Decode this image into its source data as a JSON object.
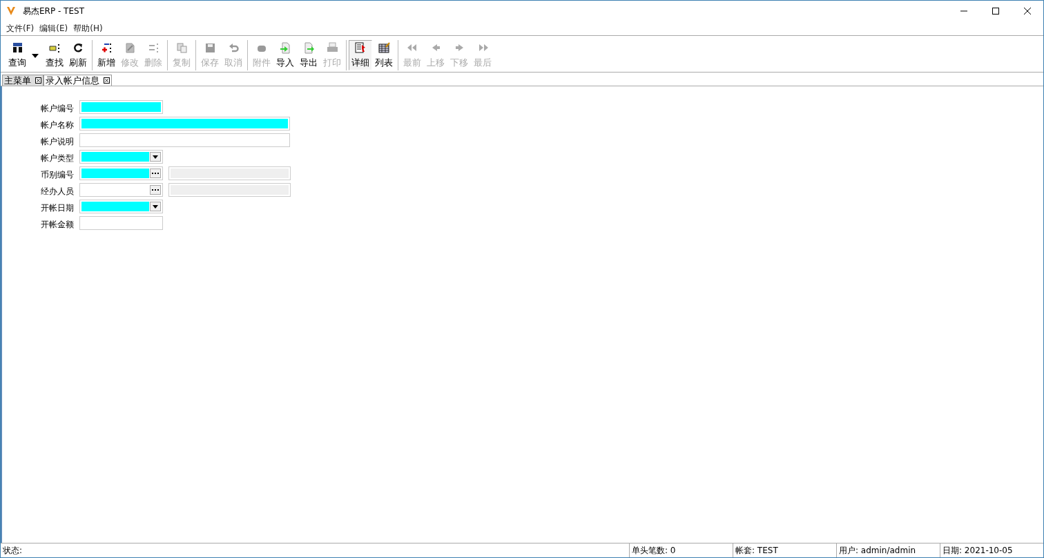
{
  "window": {
    "title": "易杰ERP - TEST"
  },
  "menu": [
    "文件(F)",
    "编辑(E)",
    "帮助(H)"
  ],
  "toolbar": [
    [
      {
        "label": "查询",
        "disabled": false,
        "selected": false,
        "has_menu": true
      },
      {
        "label": "查找",
        "disabled": false,
        "selected": false,
        "has_menu": false
      },
      {
        "label": "刷新",
        "disabled": false,
        "selected": false,
        "has_menu": false
      }
    ],
    [
      {
        "label": "新增",
        "disabled": false,
        "selected": false,
        "has_menu": false
      },
      {
        "label": "修改",
        "disabled": true,
        "selected": false,
        "has_menu": false
      },
      {
        "label": "删除",
        "disabled": true,
        "selected": false,
        "has_menu": false
      }
    ],
    [
      {
        "label": "复制",
        "disabled": true,
        "selected": false,
        "has_menu": false
      }
    ],
    [
      {
        "label": "保存",
        "disabled": true,
        "selected": false,
        "has_menu": false
      },
      {
        "label": "取消",
        "disabled": true,
        "selected": false,
        "has_menu": false
      }
    ],
    [
      {
        "label": "附件",
        "disabled": true,
        "selected": false,
        "has_menu": false
      },
      {
        "label": "导入",
        "disabled": false,
        "selected": false,
        "has_menu": false
      },
      {
        "label": "导出",
        "disabled": false,
        "selected": false,
        "has_menu": false
      },
      {
        "label": "打印",
        "disabled": true,
        "selected": false,
        "has_menu": false
      }
    ],
    [
      {
        "label": "详细",
        "disabled": false,
        "selected": true,
        "has_menu": false
      },
      {
        "label": "列表",
        "disabled": false,
        "selected": false,
        "has_menu": false
      }
    ],
    [
      {
        "label": "最前",
        "disabled": true,
        "selected": false,
        "has_menu": false
      },
      {
        "label": "上移",
        "disabled": true,
        "selected": false,
        "has_menu": false
      },
      {
        "label": "下移",
        "disabled": true,
        "selected": false,
        "has_menu": false
      },
      {
        "label": "最后",
        "disabled": true,
        "selected": false,
        "has_menu": false
      }
    ]
  ],
  "tabs": [
    {
      "label": "主菜单",
      "selected": false
    },
    {
      "label": "录入帐户信息",
      "selected": true
    }
  ],
  "form": [
    {
      "label": "帐户编号",
      "kind": "text",
      "wide": false,
      "required": true
    },
    {
      "label": "帐户名称",
      "kind": "text",
      "wide": true,
      "required": true
    },
    {
      "label": "帐户说明",
      "kind": "text",
      "wide": true,
      "required": false
    },
    {
      "label": "帐户类型",
      "kind": "dropdown",
      "wide": false,
      "required": true
    },
    {
      "label": "币别编号",
      "kind": "lookup",
      "wide": false,
      "required": true
    },
    {
      "label": "经办人员",
      "kind": "lookup",
      "wide": false,
      "required": false
    },
    {
      "label": "开帐日期",
      "kind": "dropdown",
      "wide": false,
      "required": true
    },
    {
      "label": "开帐金额",
      "kind": "text",
      "wide": false,
      "required": false
    }
  ],
  "status_bar": [
    "状态:",
    "单头笔数: 0",
    "帐套: TEST",
    "用户: admin/admin",
    "日期: 2021-10-05"
  ]
}
